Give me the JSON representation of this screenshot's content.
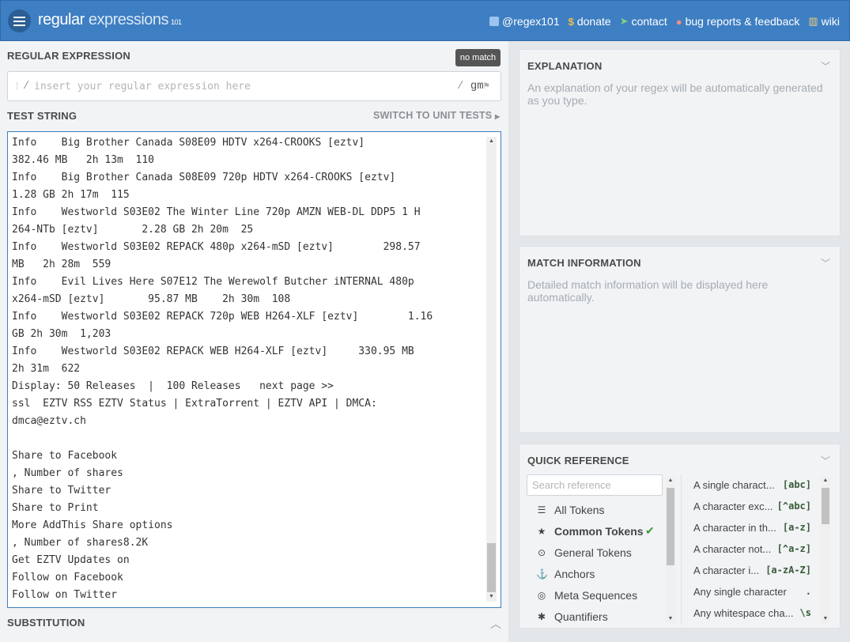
{
  "header": {
    "logo_main": "regular",
    "logo_light": "expressions",
    "logo_sub": "101",
    "links": [
      {
        "icon": "twitter-icon",
        "label": "@regex101"
      },
      {
        "icon": "dollar-icon",
        "label": "donate"
      },
      {
        "icon": "paper-plane-icon",
        "label": "contact"
      },
      {
        "icon": "bug-icon",
        "label": "bug reports & feedback"
      },
      {
        "icon": "bank-icon",
        "label": "wiki"
      }
    ]
  },
  "regex": {
    "label": "REGULAR EXPRESSION",
    "status": "no match",
    "placeholder": "insert your regular expression here",
    "delimiter": "/",
    "flags": "gm"
  },
  "test": {
    "label": "TEST STRING",
    "switch_label": "SWITCH TO UNIT TESTS",
    "lines": [
      "Info    Big Brother Canada S08E09 HDTV x264-CROOKS [eztv]",
      "382.46 MB   2h 13m  110",
      "Info    Big Brother Canada S08E09 720p HDTV x264-CROOKS [eztv]",
      "1.28 GB 2h 17m  115",
      "Info    Westworld S03E02 The Winter Line 720p AMZN WEB-DL DDP5 1 H",
      "264-NTb [eztv]       2.28 GB 2h 20m  25",
      "Info    Westworld S03E02 REPACK 480p x264-mSD [eztv]        298.57",
      "MB   2h 28m  559",
      "Info    Evil Lives Here S07E12 The Werewolf Butcher iNTERNAL 480p",
      "x264-mSD [eztv]       95.87 MB    2h 30m  108",
      "Info    Westworld S03E02 REPACK 720p WEB H264-XLF [eztv]        1.16",
      "GB 2h 30m  1,203",
      "Info    Westworld S03E02 REPACK WEB H264-XLF [eztv]     330.95 MB",
      "2h 31m  622",
      "Display: 50 Releases  |  100 Releases   next page >>",
      "ssl  EZTV RSS EZTV Status | ExtraTorrent | EZTV API | DMCA:",
      "dmca@eztv.ch",
      "",
      "Share to Facebook",
      ", Number of shares",
      "Share to Twitter",
      "Share to Print",
      "More AddThis Share options",
      ", Number of shares8.2K",
      "Get EZTV Updates on",
      "Follow on Facebook",
      "Follow on Twitter"
    ]
  },
  "substitution": {
    "label": "SUBSTITUTION"
  },
  "explanation": {
    "title": "EXPLANATION",
    "text": "An explanation of your regex will be automatically generated as you type."
  },
  "match_info": {
    "title": "MATCH INFORMATION",
    "text": "Detailed match information will be displayed here automatically."
  },
  "quick_reference": {
    "title": "QUICK REFERENCE",
    "search_placeholder": "Search reference",
    "categories": [
      {
        "icon": "database-icon",
        "label": "All Tokens",
        "active": false
      },
      {
        "icon": "star-icon",
        "label": "Common Tokens",
        "active": true
      },
      {
        "icon": "circle-dot-icon",
        "label": "General Tokens",
        "active": false
      },
      {
        "icon": "anchor-icon",
        "label": "Anchors",
        "active": false
      },
      {
        "icon": "lifebuoy-icon",
        "label": "Meta Sequences",
        "active": false
      },
      {
        "icon": "asterisk-icon",
        "label": "Quantifiers",
        "active": false
      }
    ],
    "tokens": [
      {
        "desc": "A single charact...",
        "code": "[abc]"
      },
      {
        "desc": "A character exc...",
        "code": "[^abc]"
      },
      {
        "desc": "A character in th...",
        "code": "[a-z]"
      },
      {
        "desc": "A character not...",
        "code": "[^a-z]"
      },
      {
        "desc": "A character i...",
        "code": "[a-zA-Z]"
      },
      {
        "desc": "Any single character",
        "code": "."
      },
      {
        "desc": "Any whitespace cha...",
        "code": "\\s"
      }
    ]
  }
}
